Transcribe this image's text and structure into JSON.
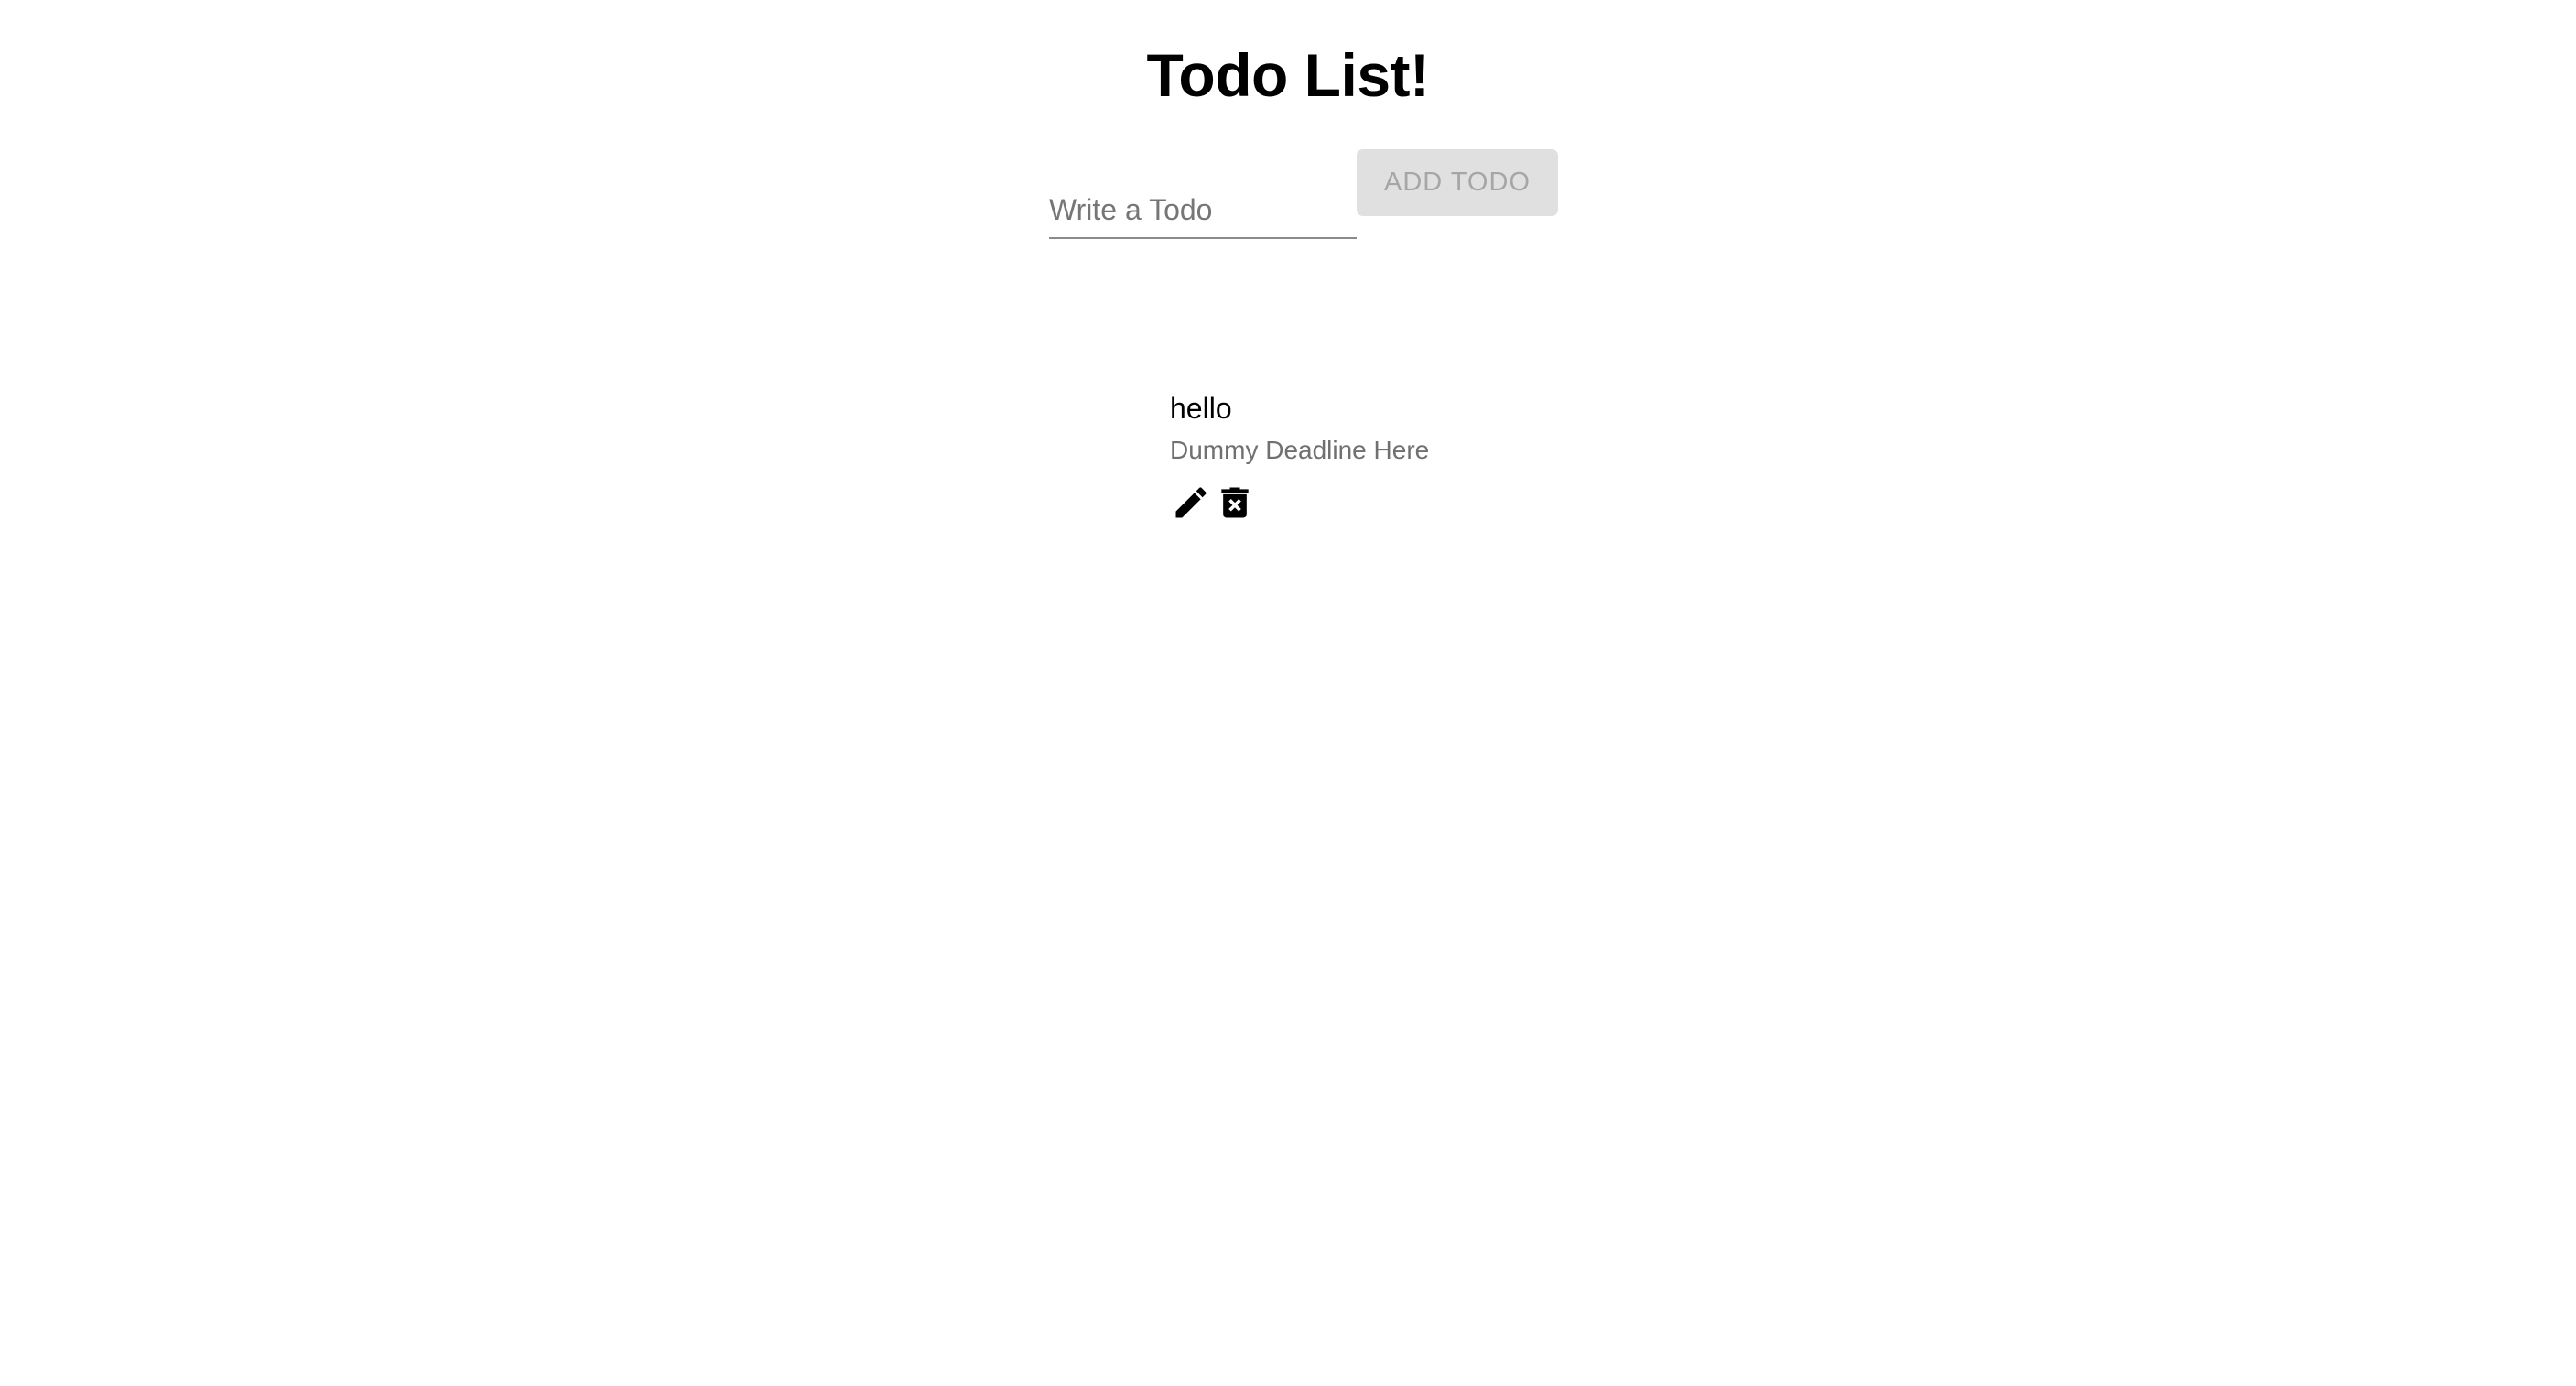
{
  "header": {
    "title": "Todo List!"
  },
  "form": {
    "input_value": "",
    "input_placeholder": "Write a Todo",
    "add_button_label": "ADD TODO",
    "add_button_enabled": false
  },
  "todos": [
    {
      "text": "hello",
      "deadline": "Dummy Deadline Here",
      "actions": [
        {
          "icon": "pencil-icon"
        },
        {
          "icon": "trash-icon"
        }
      ]
    }
  ],
  "colors": {
    "background": "#ffffff",
    "text": "#000000",
    "secondary_text": "#707070",
    "button_disabled_bg": "#e0e0e0",
    "button_disabled_text": "#a6a6a6",
    "input_underline": "#8a8a8a"
  }
}
